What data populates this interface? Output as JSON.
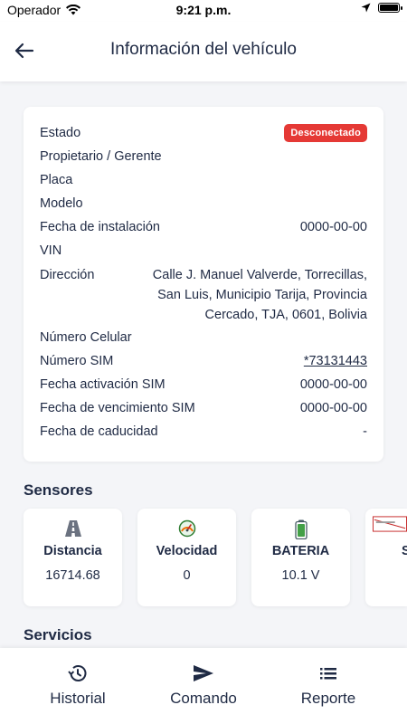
{
  "status_bar": {
    "carrier": "Operador",
    "time": "9:21 p.m."
  },
  "header": {
    "title": "Información del vehículo"
  },
  "vehicle_info": {
    "estado_label": "Estado",
    "estado_value": "Desconectado",
    "propietario_label": "Propietario / Gerente",
    "placa_label": "Placa",
    "modelo_label": "Modelo",
    "fecha_instalacion_label": "Fecha de instalación",
    "fecha_instalacion_value": "0000-00-00",
    "vin_label": "VIN",
    "direccion_label": "Dirección",
    "direccion_value": "Calle J. Manuel Valverde, Torrecillas, San Luis, Municipio Tarija, Provincia Cercado, TJA, 0601, Bolivia",
    "numero_celular_label": "Número Celular",
    "numero_sim_label": "Número SIM",
    "numero_sim_value": "*73131443",
    "fecha_activacion_label": "Fecha activación SIM",
    "fecha_activacion_value": "0000-00-00",
    "fecha_vencimiento_label": "Fecha de vencimiento SIM",
    "fecha_vencimiento_value": "0000-00-00",
    "fecha_caducidad_label": "Fecha de caducidad",
    "fecha_caducidad_value": "-"
  },
  "colors": {
    "badge_red": "#e53935",
    "text_dark": "#1f2a44",
    "background": "#f4f5f8"
  },
  "sensors": {
    "title": "Sensores",
    "items": [
      {
        "icon": "road-icon",
        "label": "Distancia",
        "value": "16714.68"
      },
      {
        "icon": "speedometer-icon",
        "label": "Velocidad",
        "value": "0"
      },
      {
        "icon": "battery-icon",
        "label": "BATERIA",
        "value": "10.1 V"
      },
      {
        "icon": "sensor-image-icon",
        "label": "S",
        "value": ""
      }
    ]
  },
  "services": {
    "title": "Servicios"
  },
  "bottom_nav": {
    "historial": "Historial",
    "comando": "Comando",
    "reporte": "Reporte"
  }
}
